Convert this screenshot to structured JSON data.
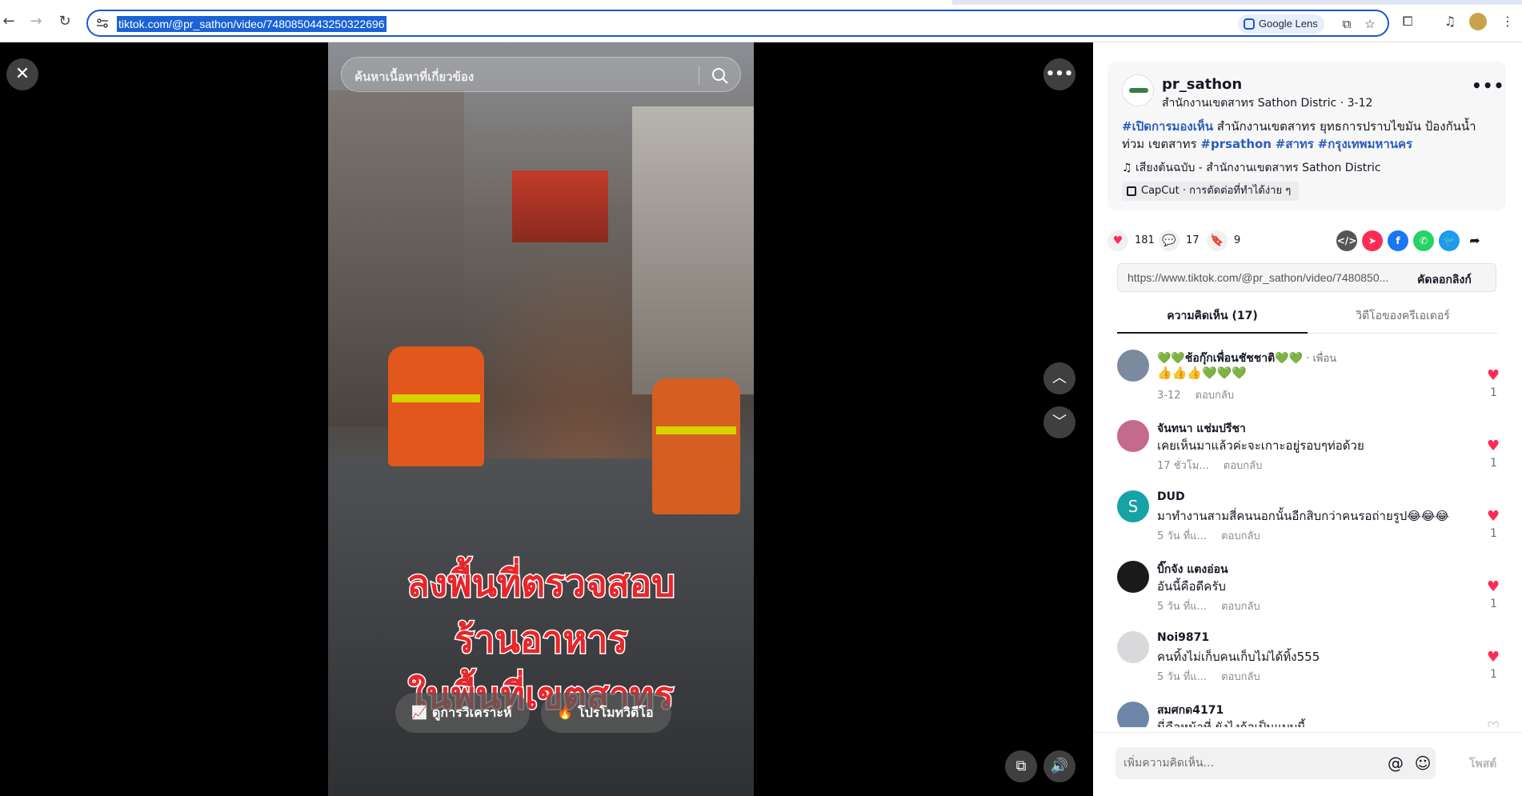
{
  "browser": {
    "url": "tiktok.com/@pr_sathon/video/7480850443250322696",
    "lens_label": "Google Lens"
  },
  "video": {
    "search_placeholder": "ค้นหาเนื้อหาที่เกี่ยวข้อง",
    "caption_lines": [
      "ลงพื้นที่ตรวจสอบ",
      "ร้านอาหาร",
      "ในพื้นที่เขตสาทร"
    ],
    "analytics_label": "ดูการวิเคราะห์",
    "promote_label": "โปรโมทวิดีโอ"
  },
  "post": {
    "username": "pr_sathon",
    "subtitle": "สำนักงานเขตสาทร Sathon Distric · 3-12",
    "description_parts": [
      {
        "text": "#เปิดการมองเห็น",
        "tag": true
      },
      {
        "text": " สำนักงานเขตสาทร ยุทธการปราบไขมัน ป้องกันน้ำท่วม เขตสาทร ",
        "tag": false
      },
      {
        "text": "#prsathon",
        "tag": true
      },
      {
        "text": " ",
        "tag": false
      },
      {
        "text": "#สาทร",
        "tag": true
      },
      {
        "text": " ",
        "tag": false
      },
      {
        "text": "#กรุงเทพมหานคร",
        "tag": true
      }
    ],
    "music": "เสียงต้นฉบับ - สำนักงานเขตสาทร Sathon Distric",
    "capcut": "CapCut · การตัดต่อที่ทำได้ง่าย ๆ",
    "likes": "181",
    "comments": "17",
    "saves": "9",
    "link": "https://www.tiktok.com/@pr_sathon/video/7480850...",
    "copy_label": "คัดลอกลิงก์"
  },
  "tabs": [
    {
      "label": "ความคิดเห็น (17)",
      "active": true
    },
    {
      "label": "วิดีโอของครีเอเตอร์",
      "active": false
    }
  ],
  "comments": [
    {
      "name": "💚💚ช้อกุ๊กเพื่อนชัชชาติ💚💚",
      "friend": " · เพื่อน",
      "text": "👍👍👍💚💚💚",
      "time": "3-12",
      "reply": "ตอบกลับ",
      "likes": "1",
      "avatar": "#7c8aa0"
    },
    {
      "name": "จันทนา แช่มปรีชา",
      "friend": "",
      "text": "เคยเห็นมาแล้วค่ะจะเกาะอยู่รอบๆท่อด้วย",
      "time": "17 ชั่วโม...",
      "reply": "ตอบกลับ",
      "likes": "1",
      "avatar": "#c46a8c"
    },
    {
      "name": "DUD",
      "friend": "",
      "text": "มาทำงานสามสี่คนนอกนั้นอีกสิบกว่าคนรอถ่ายรูป😂😂😂",
      "time": "5 วัน ที่แ...",
      "reply": "ตอบกลับ",
      "likes": "1",
      "avatar": "#17a2a6",
      "initial": "S"
    },
    {
      "name": "บิ๊กจัง แตงอ่อน",
      "friend": "",
      "text": "อันนี้คือดีครับ",
      "time": "5 วัน ที่แ...",
      "reply": "ตอบกลับ",
      "likes": "1",
      "avatar": "#1a1a1a"
    },
    {
      "name": "Noi9871",
      "friend": "",
      "text": "คนทิ้งไม่เก็บคนเก็บไม่ได้ทิ้ง555",
      "time": "5 วัน ที่แ...",
      "reply": "ตอบกลับ",
      "likes": "1",
      "avatar": "#d9d9dc"
    },
    {
      "name": "สมศกด4171",
      "friend": "",
      "text": "นี่คือหน้าที่ ยังไงก้อเป็นแบบนี้",
      "time": "",
      "reply": "",
      "likes": "",
      "avatar": "#6e86a8"
    }
  ],
  "composer": {
    "placeholder": "เพิ่มความคิดเห็น...",
    "post_label": "โพสต์"
  }
}
